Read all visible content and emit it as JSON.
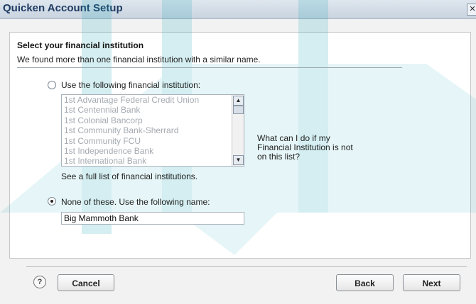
{
  "window": {
    "title": "Quicken Account Setup",
    "close_glyph": "✕"
  },
  "section": {
    "heading": "Select your financial institution",
    "subtext": "We found more than one financial institution with a similar name."
  },
  "option_list": {
    "label": "Use the following financial institution:",
    "selected": false,
    "items": [
      "1st Advantage Federal Credit Union",
      "1st Centennial Bank",
      "1st Colonial Bancorp",
      "1st Community Bank-Sherrard",
      "1st Community FCU",
      "1st Independence Bank",
      "1st International Bank"
    ],
    "scroll_up_icon": "▲",
    "scroll_down_icon": "▼",
    "full_list_link": "See a full list of financial institutions.",
    "help_link": "What can I do if my Financial Institution is not on this list?"
  },
  "option_name": {
    "label": "None of these. Use the following name:",
    "selected": true,
    "value": "Big Mammoth Bank"
  },
  "footer": {
    "help_icon": "?",
    "cancel_label": "Cancel",
    "back_label": "Back",
    "next_label": "Next"
  },
  "colors": {
    "watermark": "#1aa7b7"
  }
}
